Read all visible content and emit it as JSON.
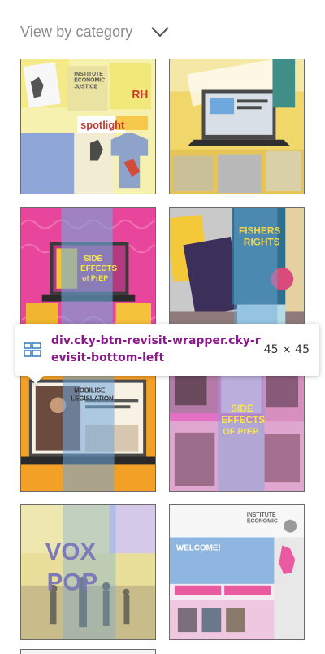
{
  "header": {
    "title": "View by category"
  },
  "inspector": {
    "selector": "div.cky-btn-revisit-wrapper.cky-revisit-bottom-left",
    "dimensions": "45 × 45"
  },
  "tiles": [
    {
      "texts": [
        "INSTITUTE",
        "ECONOMIC",
        "JUSTICE",
        "spotlight",
        "RH"
      ]
    },
    {
      "texts": []
    },
    {
      "texts": [
        "SIDE",
        "EFFECTS",
        "of PrEP"
      ]
    },
    {
      "texts": [
        "FISHERS",
        "RIGHTS"
      ]
    },
    {
      "texts": [
        "MOBILISE",
        "LEGISLATION"
      ]
    },
    {
      "texts": [
        "SIDE",
        "EFFECTS",
        "OF PrEP"
      ]
    },
    {
      "texts": [
        "VOX",
        "POP"
      ]
    },
    {
      "texts": [
        "INSTITUTE",
        "ECONOMIC",
        "WELCOME!"
      ]
    }
  ],
  "colors": {
    "header_text": "#8c8c8c",
    "selector_text": "#8a1a8a",
    "overlay_blue": "#6fa8dc",
    "overlay_yellow": "#f2e27a",
    "overlay_pink": "#e66fc9"
  }
}
